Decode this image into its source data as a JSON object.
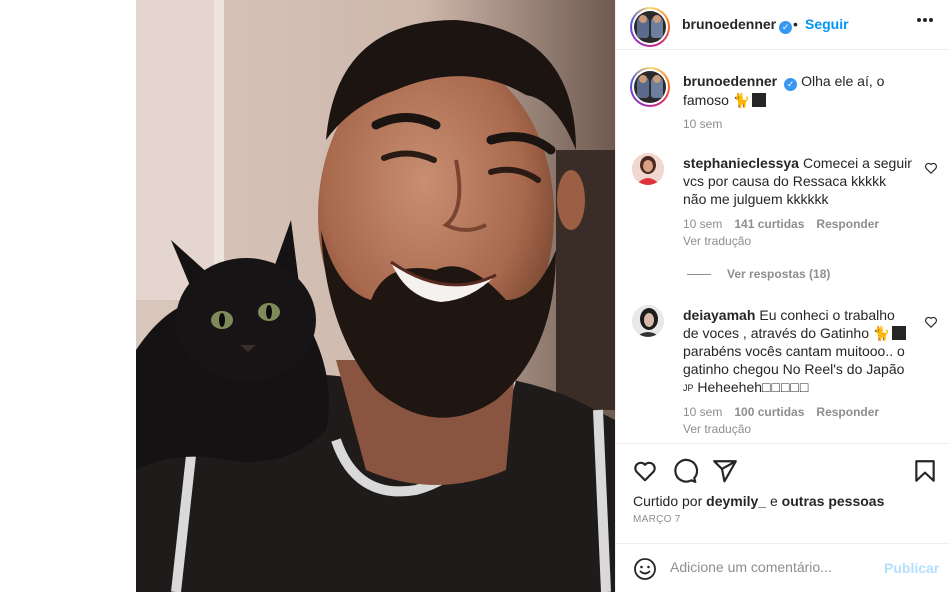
{
  "post": {
    "author": "brunoedenner",
    "follow_label": "Seguir",
    "separator": "•"
  },
  "caption": {
    "username": "brunoedenner",
    "text": "Olha ele aí, o famoso",
    "emoji": "🐈",
    "time": "10 sem"
  },
  "comments": [
    {
      "username": "stephanieclessya",
      "text": "Comecei a seguir vcs por causa do Ressaca kkkkk não me julguem kkkkkk",
      "time": "10 sem",
      "likes": "141 curtidas",
      "reply_label": "Responder",
      "translate_label": "Ver tradução",
      "view_replies": "Ver respostas (18)"
    },
    {
      "username": "deiayamah",
      "text_part1": "Eu conheci o trabalho de voces , através do Gatinho",
      "emoji": "🐈",
      "text_part2": "parabéns vocês cantam muitooo.. o gatinho chegou No Reel's do Japão",
      "text_part3": "Heheeheh",
      "jp_tag": "JP",
      "time": "10 sem",
      "likes": "100 curtidas",
      "reply_label": "Responder",
      "translate_label": "Ver tradução"
    }
  ],
  "actions": {
    "liked_by_prefix": "Curtido por",
    "liked_by_user": "deymily_",
    "liked_by_connector": "e",
    "liked_by_others": "outras pessoas",
    "date": "Março 7"
  },
  "add_comment": {
    "placeholder": "Adicione um comentário...",
    "publish_label": "Publicar"
  },
  "colors": {
    "accent": "#0095f6",
    "publish_disabled": "#b2dffc",
    "muted": "#8e8e8e",
    "verified": "#3897f0"
  },
  "icons": [
    "more-options-icon",
    "verified-badge-icon",
    "heart-icon",
    "comment-icon",
    "share-icon",
    "bookmark-icon",
    "emoji-icon"
  ]
}
